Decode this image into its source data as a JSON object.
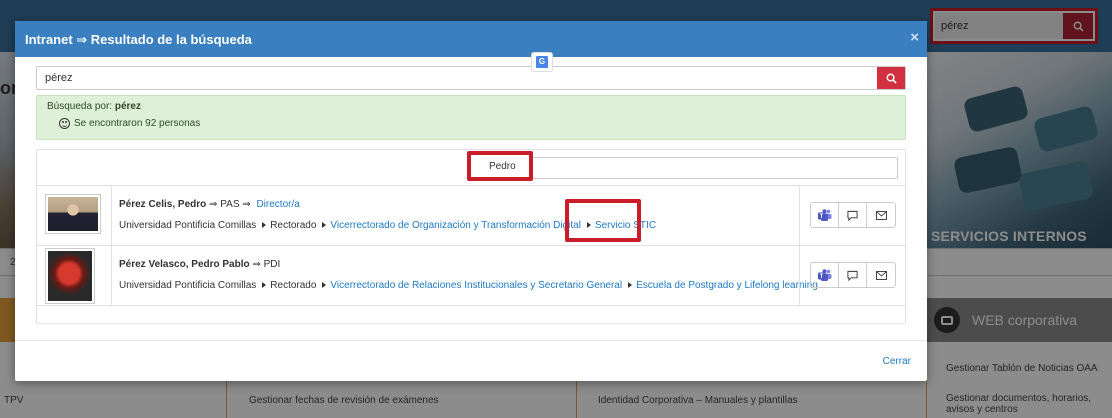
{
  "background": {
    "search_value": "pérez",
    "hero_title_fragment": "or",
    "hero_right_label": "SERVICIOS INTERNOS",
    "stripe_number": "2",
    "web_label": "WEB corporativa",
    "columns": [
      "TPV",
      "Gestionar fechas de revisión de exámenes",
      "Identidad Corporativa – Manuales y plantillas",
      "Gestionar Tablón de Noticias OAA",
      "Gestionar documentos, horarios, avisos y centros"
    ]
  },
  "modal": {
    "title": "Intranet ⇒ Resultado de la búsqueda",
    "close_glyph": "×",
    "search_value": "pérez",
    "alert": {
      "label": "Búsqueda por:",
      "term": "pérez",
      "result_text": "Se encontraron 92 personas"
    },
    "filter_value": "Pedro",
    "people": [
      {
        "name": "Pérez Celis, Pedro",
        "type": "PAS",
        "role": "Director/a",
        "path_root": "Universidad Pontificia Comillas",
        "path_mid": "Rectorado",
        "path_link1": "Vicerrectorado de Organización y Transformación Digital",
        "path_link2": "Servicio STIC"
      },
      {
        "name": "Pérez Velasco, Pedro Pablo",
        "type": "PDI",
        "path_root": "Universidad Pontificia Comillas",
        "path_mid": "Rectorado",
        "path_link1": "Vicerrectorado de Relaciones Institucionales y Secretario General",
        "path_link2": "Escuela de Postgrado y Lifelong learning"
      }
    ],
    "footer_close": "Cerrar"
  },
  "arrow": "⇒",
  "colors": {
    "header_blue": "#3a7fbf",
    "highlight_red": "#c91d2a",
    "search_button_red": "#d23040",
    "alert_green": "#dff0d8",
    "link_blue": "#1f79c4",
    "web_orange": "#e8a03d"
  },
  "icons": [
    "search-icon",
    "close-icon",
    "translate-icon",
    "smiley-icon",
    "teams-icon",
    "chat-icon",
    "mail-icon",
    "briefcase-icon"
  ]
}
